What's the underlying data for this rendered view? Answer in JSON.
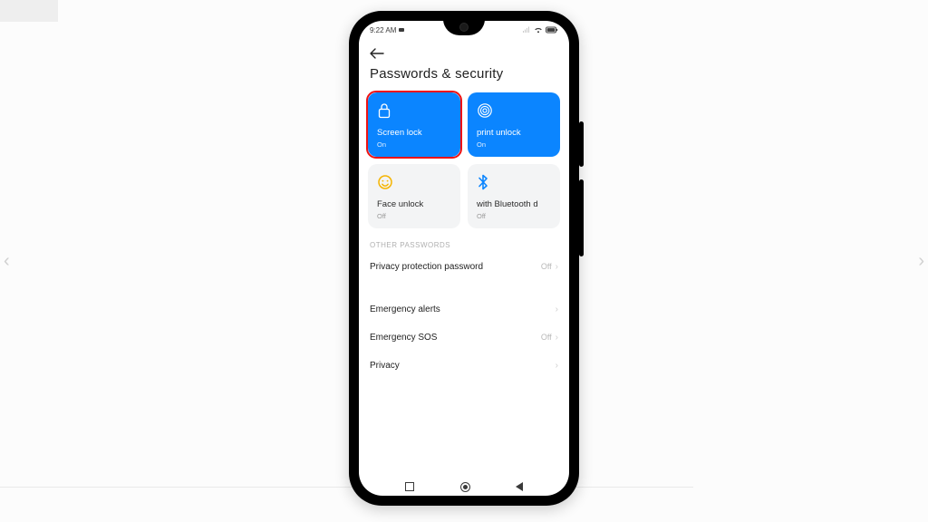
{
  "status_bar": {
    "time": "9:22 AM"
  },
  "header": {
    "title": "Passwords & security"
  },
  "tiles": [
    {
      "label": "Screen lock",
      "status": "On",
      "highlight": true
    },
    {
      "label": "print unlock",
      "status": "On"
    },
    {
      "label": "Face unlock",
      "status": "Off"
    },
    {
      "label": "with Bluetooth d",
      "status": "Off"
    }
  ],
  "section_other": {
    "heading": "OTHER PASSWORDS",
    "rows": [
      {
        "label": "Privacy protection password",
        "value": "Off"
      }
    ]
  },
  "section_misc": {
    "rows": [
      {
        "label": "Emergency alerts",
        "value": ""
      },
      {
        "label": "Emergency SOS",
        "value": "Off"
      },
      {
        "label": "Privacy",
        "value": ""
      }
    ]
  }
}
